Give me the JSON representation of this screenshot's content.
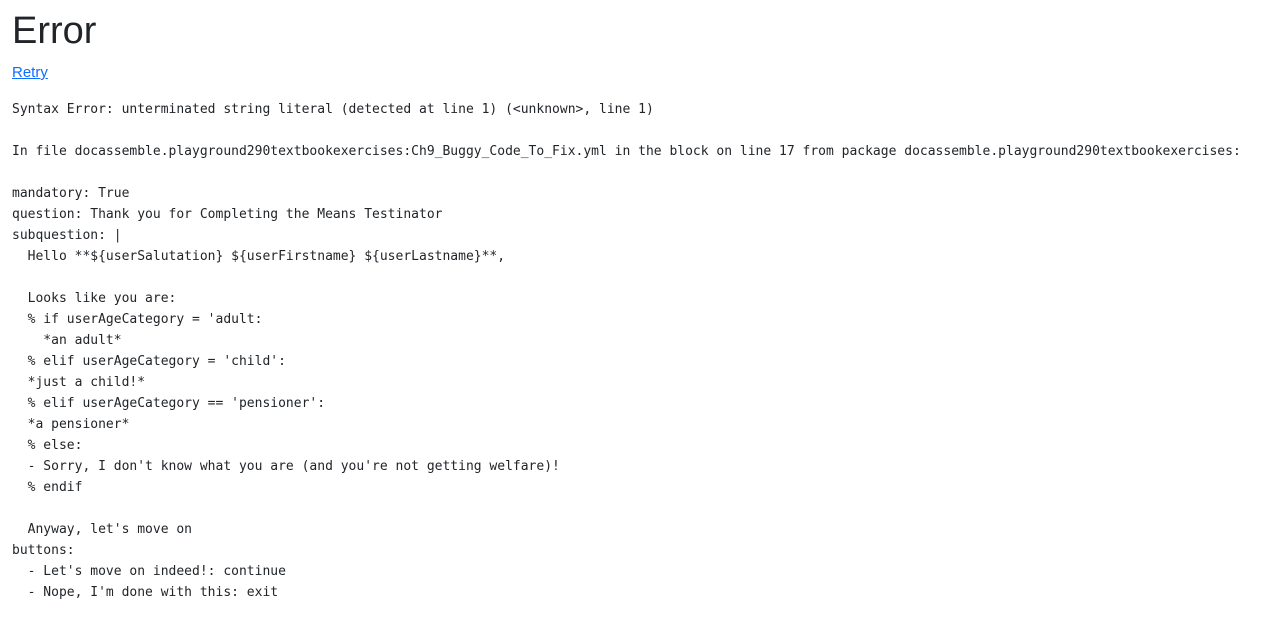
{
  "page": {
    "title": "Error",
    "retry_label": "Retry",
    "error_message": "Syntax Error: unterminated string literal (detected at line 1) (<unknown>, line 1)",
    "file_info": "In file docassemble.playground290textbookexercises:Ch9_Buggy_Code_To_Fix.yml in the block on line 17 from package docassemble.playground290textbookexercises:",
    "code": "mandatory: True\nquestion: Thank you for Completing the Means Testinator\nsubquestion: |\n  Hello **${userSalutation} ${userFirstname} ${userLastname}**,\n\n  Looks like you are:\n  % if userAgeCategory = 'adult:\n    *an adult*\n  % elif userAgeCategory = 'child':\n  *just a child!*\n  % elif userAgeCategory == 'pensioner':\n  *a pensioner*\n  % else:\n  - Sorry, I don't know what you are (and you're not getting welfare)!\n  % endif\n\n  Anyway, let's move on\nbuttons:\n  - Let's move on indeed!: continue\n  - Nope, I'm done with this: exit"
  }
}
